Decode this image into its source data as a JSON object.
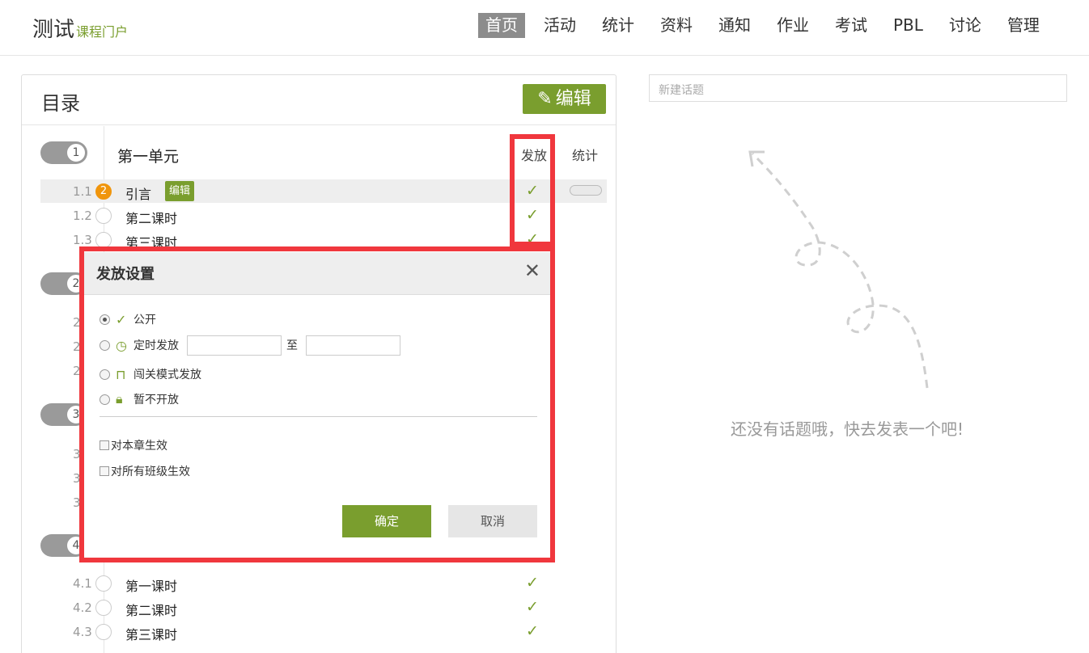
{
  "header": {
    "logo_main": "测试",
    "logo_sub": "课程门户",
    "nav": [
      "首页",
      "活动",
      "统计",
      "资料",
      "通知",
      "作业",
      "考试",
      "PBL",
      "讨论",
      "管理"
    ],
    "active_nav": "首页"
  },
  "catalog": {
    "title": "目录",
    "edit_label": "编辑",
    "col_release": "发放",
    "col_stats": "统计",
    "units": [
      {
        "num": "1",
        "title": "第一单元",
        "lessons": [
          {
            "num": "1.1",
            "badge": "2",
            "title": "引言",
            "tag": "编辑"
          },
          {
            "num": "1.2",
            "title": "第二课时"
          },
          {
            "num": "1.3",
            "title": "第三课时"
          }
        ]
      },
      {
        "num": "2",
        "lesson_prefix": [
          "2",
          "2",
          "2"
        ]
      },
      {
        "num": "3",
        "lesson_prefix": [
          "3",
          "3",
          "3"
        ]
      },
      {
        "num": "4",
        "lessons": [
          {
            "num": "4.1",
            "title": "第一课时"
          },
          {
            "num": "4.2",
            "title": "第二课时"
          },
          {
            "num": "4.3",
            "title": "第三课时"
          }
        ]
      }
    ]
  },
  "dialog": {
    "title": "发放设置",
    "close": "✕",
    "options": {
      "public": "公开",
      "timed": "定时发放",
      "to": "至",
      "level": "闯关模式发放",
      "closed": "暂不开放"
    },
    "selected": "public",
    "checks": {
      "chapter": "对本章生效",
      "all_classes": "对所有班级生效"
    },
    "ok": "确定",
    "cancel": "取消"
  },
  "topic": {
    "placeholder": "新建话题",
    "empty": "还没有话题哦，快去发表一个吧!"
  },
  "colors": {
    "accent": "#7a9e2e",
    "badge": "#f0950c",
    "highlight_frame": "#f0373d"
  },
  "icons": {
    "edit": "pencil-icon",
    "check": "check-icon",
    "clock": "clock-icon",
    "level": "gate-icon",
    "lock": "lock-icon",
    "close": "close-icon"
  }
}
